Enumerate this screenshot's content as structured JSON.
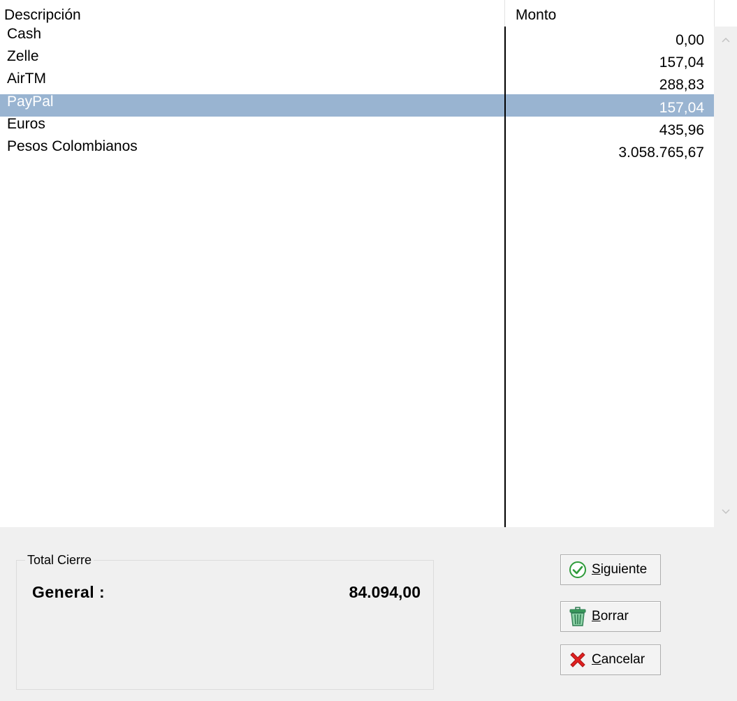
{
  "grid": {
    "columns": {
      "descripcion": "Descripción",
      "monto": "Monto"
    },
    "rows": [
      {
        "descripcion": "Cash",
        "monto": "0,00",
        "selected": false
      },
      {
        "descripcion": "Zelle",
        "monto": "157,04",
        "selected": false
      },
      {
        "descripcion": "AirTM",
        "monto": "288,83",
        "selected": false
      },
      {
        "descripcion": "PayPal",
        "monto": "157,04",
        "selected": true
      },
      {
        "descripcion": "Euros",
        "monto": "435,96",
        "selected": false
      },
      {
        "descripcion": "Pesos Colombianos",
        "monto": "3.058.765,67",
        "selected": false
      }
    ]
  },
  "scrollbar": {
    "up_icon": "chevron-up-icon",
    "down_icon": "chevron-down-icon"
  },
  "total": {
    "group_title": "Total Cierre",
    "label": "General :",
    "value": "84.094,00"
  },
  "buttons": {
    "siguiente": {
      "mnemonic": "S",
      "rest": "iguiente",
      "icon": "check-circle-icon"
    },
    "borrar": {
      "mnemonic": "B",
      "rest": "orrar",
      "icon": "trash-icon"
    },
    "cancelar": {
      "mnemonic": "C",
      "rest": "ancelar",
      "icon": "red-x-icon"
    }
  },
  "colors": {
    "selection": "#99b4d1",
    "check_green": "#2e9b3a",
    "trash_green": "#3a9b5c",
    "cancel_red": "#e02020"
  }
}
